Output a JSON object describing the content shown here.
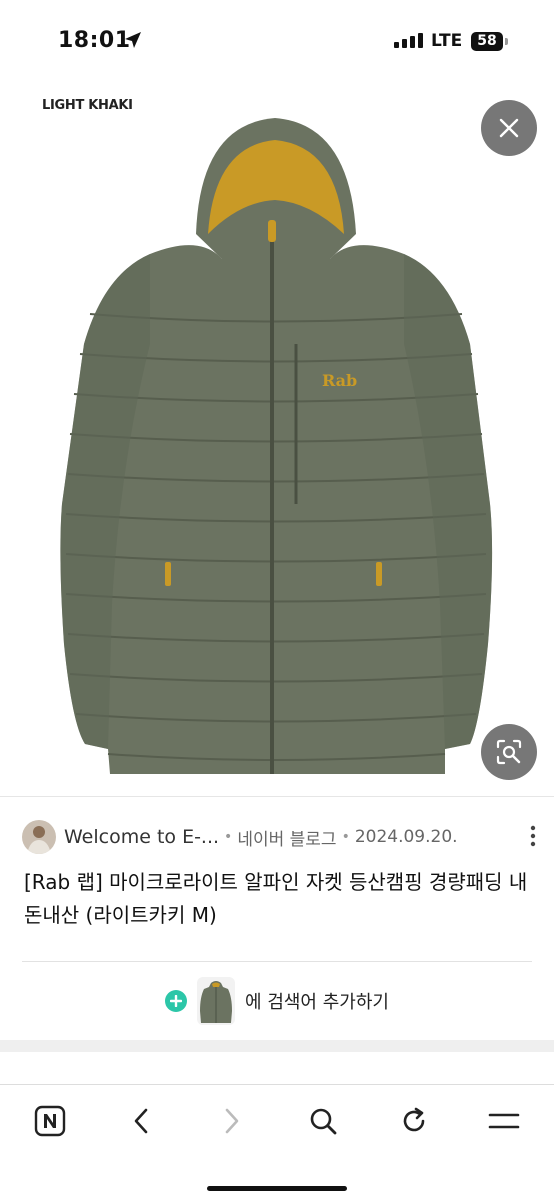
{
  "status": {
    "time": "18:01",
    "network": "LTE",
    "battery": "58"
  },
  "image": {
    "variant_label": "LIGHT KHAKI",
    "brand_text": "Rab"
  },
  "result": {
    "site_name": "Welcome to E-...",
    "source_type": "네이버 블로그",
    "date": "2024.09.20.",
    "title": "[Rab 랩] 마이크로라이트 알파인 자켓 등산캠핑 경량패딩 내돈내산 (라이트카키 M)"
  },
  "add_search": {
    "text": "에 검색어 추가하기"
  },
  "toolbar": {
    "icons": [
      "naver-n-icon",
      "back-icon",
      "forward-icon",
      "search-icon",
      "refresh-icon",
      "menu-icon"
    ]
  },
  "colors": {
    "jacket": "#6b7361",
    "lining": "#c99a26",
    "accent": "#2cc6a8",
    "button_bg": "#777777"
  }
}
